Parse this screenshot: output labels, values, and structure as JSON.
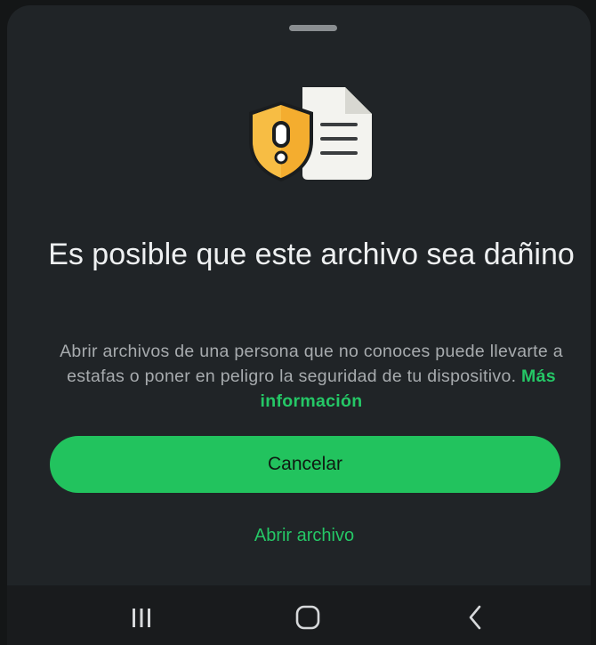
{
  "dialog": {
    "title": "Es posible que este archivo sea dañino",
    "description": "Abrir archivos de una persona que no conoces puede llevarte a estafas o poner en peligro la seguridad de tu dispositivo.",
    "learn_more_label": "Más información",
    "hero_icon": "shield-warning-document-icon"
  },
  "actions": {
    "cancel_label": "Cancelar",
    "open_label": "Abrir archivo"
  },
  "navbar": {
    "recents_icon": "recent-apps-icon",
    "home_icon": "home-icon",
    "back_icon": "back-icon"
  },
  "colors": {
    "accent": "#22c35e",
    "link": "#25c766",
    "sheet_background": "#202427",
    "warning_shield": "#f4ad2f"
  }
}
